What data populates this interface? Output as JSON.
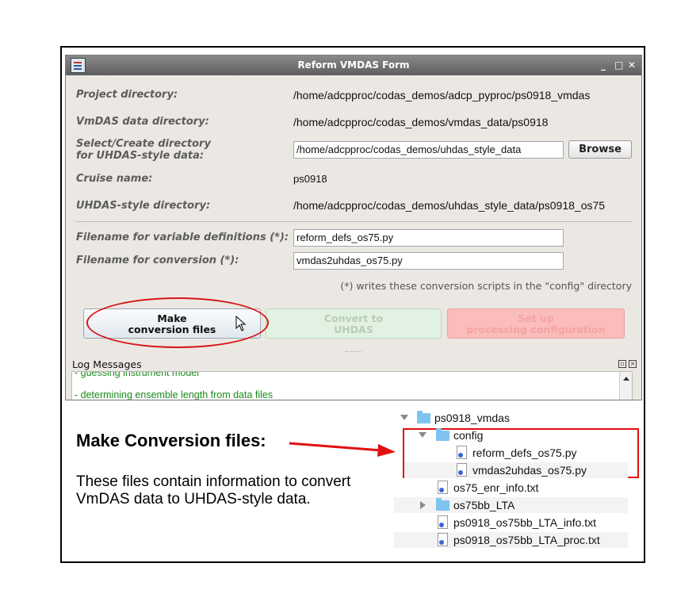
{
  "window": {
    "title": "Reform VMDAS Form",
    "controls": {
      "minimize": "_",
      "maximize": "□",
      "close": "✕"
    }
  },
  "form": {
    "project_directory": {
      "label": "Project directory:",
      "value": "/home/adcpproc/codas_demos/adcp_pyproc/ps0918_vmdas"
    },
    "vmdas_directory": {
      "label": "VmDAS data directory:",
      "value": "/home/adcpproc/codas_demos/vmdas_data/ps0918"
    },
    "uhdas_style_select": {
      "label_line1": "Select/Create directory",
      "label_line2": "for UHDAS-style data:",
      "value": "/home/adcpproc/codas_demos/uhdas_style_data",
      "browse_label": "Browse"
    },
    "cruise_name": {
      "label": "Cruise name:",
      "value": "ps0918"
    },
    "uhdas_style_directory": {
      "label": "UHDAS-style directory:",
      "value": "/home/adcpproc/codas_demos/uhdas_style_data/ps0918_os75"
    },
    "var_defs_filename": {
      "label": "Filename for variable definitions (*):",
      "value": "reform_defs_os75.py"
    },
    "conversion_filename": {
      "label": "Filename for conversion (*):",
      "value": "vmdas2uhdas_os75.py"
    },
    "note": "(*) writes these conversion scripts in the \"config\" directory"
  },
  "buttons": {
    "make": {
      "line1": "Make",
      "line2": "conversion files"
    },
    "convert": {
      "line1": "Convert to",
      "line2": "UHDAS"
    },
    "setup": {
      "line1": "Set up",
      "line2": "processing configuration"
    }
  },
  "log": {
    "label": "Log Messages",
    "lines": [
      "- guessing instrument model",
      "- determining ensemble length from data files"
    ],
    "colors": {
      "text": "#1b8a1b"
    }
  },
  "annotation": {
    "heading": "Make Conversion files:",
    "description": "These files contain information to convert VmDAS data to UHDAS-style data.",
    "highlight_color": "#e01010"
  },
  "file_tree": [
    {
      "name": "ps0918_vmdas",
      "type": "folder",
      "expanded": true
    },
    {
      "name": "config",
      "type": "folder",
      "expanded": true
    },
    {
      "name": "reform_defs_os75.py",
      "type": "file"
    },
    {
      "name": "vmdas2uhdas_os75.py",
      "type": "file"
    },
    {
      "name": "os75_enr_info.txt",
      "type": "file"
    },
    {
      "name": "os75bb_LTA",
      "type": "folder",
      "expanded": false
    },
    {
      "name": "ps0918_os75bb_LTA_info.txt",
      "type": "file"
    },
    {
      "name": "ps0918_os75bb_LTA_proc.txt",
      "type": "file"
    }
  ]
}
